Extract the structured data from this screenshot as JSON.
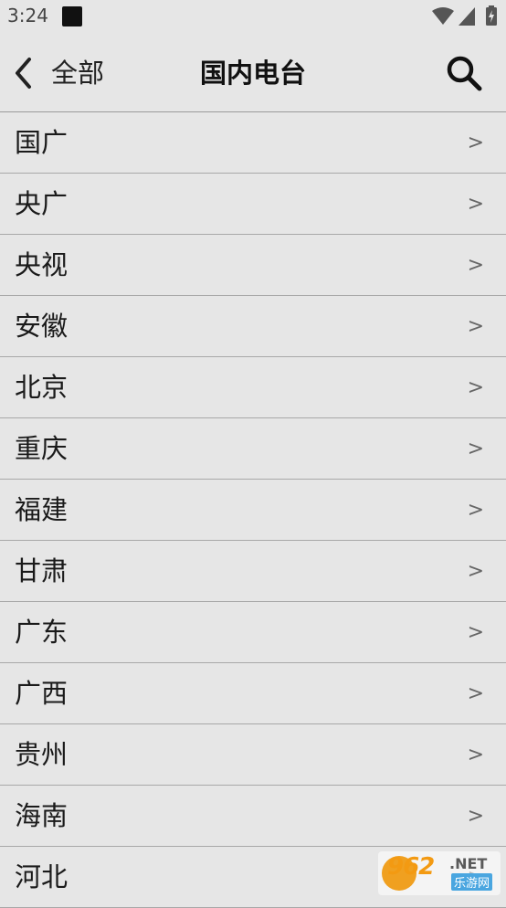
{
  "status_bar": {
    "time": "3:24",
    "icons": [
      "notification-square-icon",
      "wifi-icon",
      "signal-icon",
      "battery-charging-icon"
    ]
  },
  "toolbar": {
    "back_label": "全部",
    "title": "国内电台",
    "back_icon": "chevron-left-icon",
    "search_icon": "search-icon"
  },
  "list": {
    "chevron": ">",
    "items": [
      {
        "label": "国广"
      },
      {
        "label": "央广"
      },
      {
        "label": "央视"
      },
      {
        "label": "安徽"
      },
      {
        "label": "北京"
      },
      {
        "label": "重庆"
      },
      {
        "label": "福建"
      },
      {
        "label": "甘肃"
      },
      {
        "label": "广东"
      },
      {
        "label": "广西"
      },
      {
        "label": "贵州"
      },
      {
        "label": "海南"
      },
      {
        "label": "河北"
      }
    ]
  },
  "watermark": {
    "number": "962",
    "net": ".NET",
    "sub": "乐游网"
  }
}
